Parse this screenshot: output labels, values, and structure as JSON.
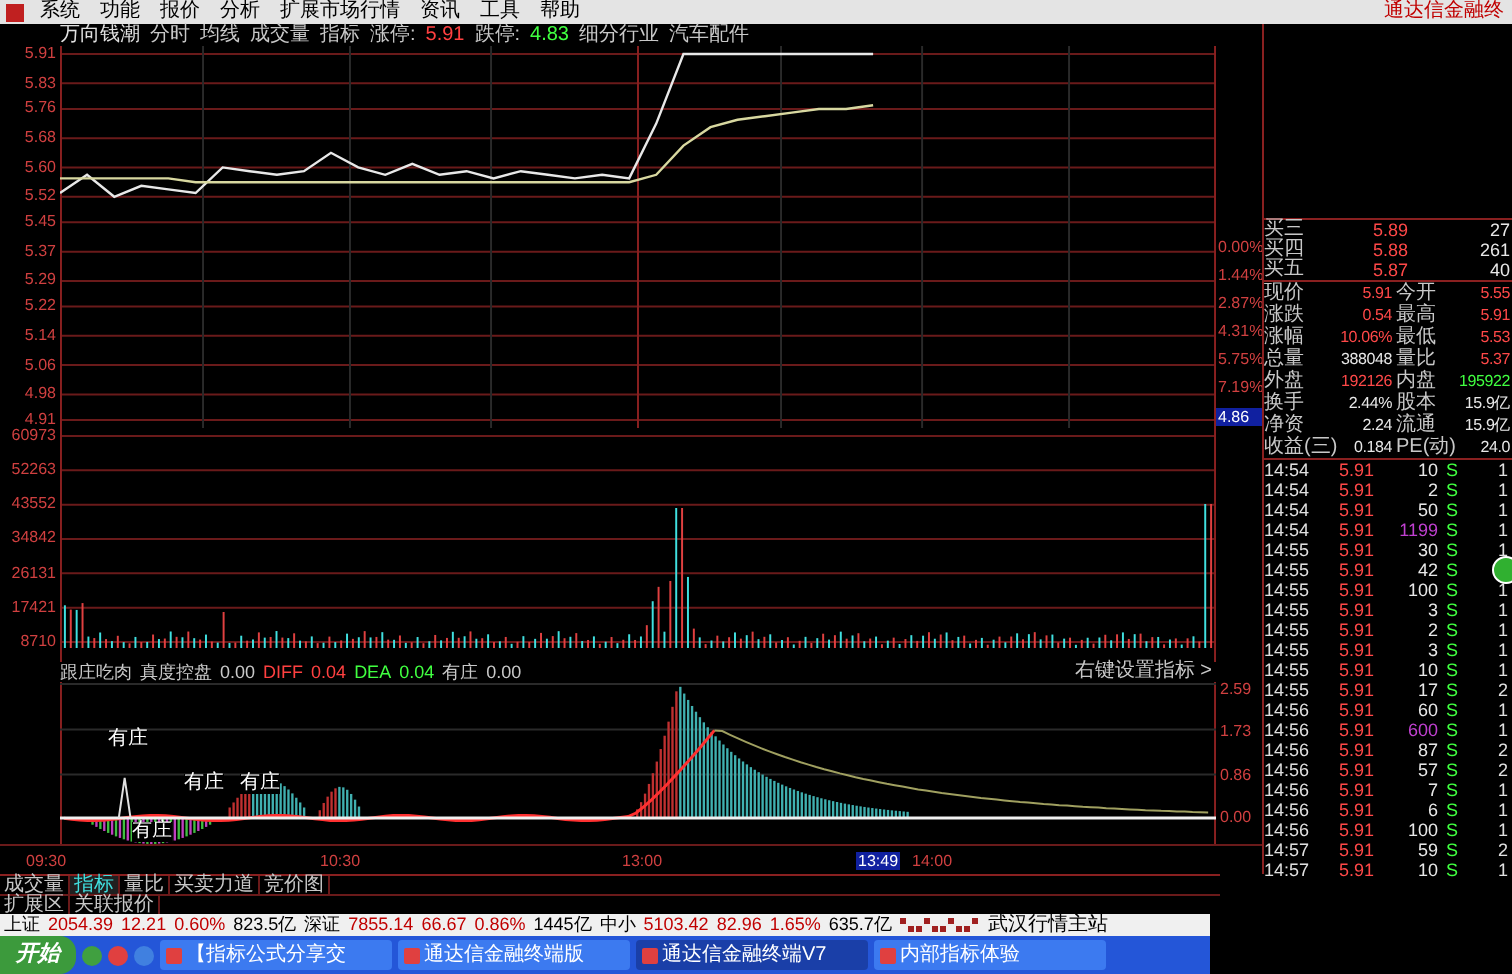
{
  "menu": [
    "系统",
    "功能",
    "报价",
    "分析",
    "扩展市场行情",
    "资讯",
    "工具",
    "帮助"
  ],
  "app_title": "通达信金融终",
  "chart_header": [
    {
      "text": "万向钱潮",
      "kind": "name"
    },
    {
      "text": "分时",
      "kind": "label"
    },
    {
      "text": "均线",
      "kind": "label"
    },
    {
      "text": "成交量",
      "kind": "label"
    },
    {
      "text": "指标",
      "kind": "label"
    },
    {
      "text": "涨停:",
      "kind": "label"
    },
    {
      "text": "5.91",
      "kind": "up"
    },
    {
      "text": "跌停:",
      "kind": "label"
    },
    {
      "text": "4.83",
      "kind": "down"
    },
    {
      "text": "细分行业",
      "kind": "label"
    },
    {
      "text": "汽车配件",
      "kind": "label"
    }
  ],
  "price_chart": {
    "chart_data": {
      "type": "line",
      "categories": [
        null,
        null,
        null,
        null,
        null,
        null,
        null,
        null,
        null,
        null,
        null,
        null,
        null,
        null,
        null,
        null,
        null,
        null,
        null,
        null,
        null,
        null,
        null,
        null,
        null,
        null,
        null,
        null,
        null,
        null,
        null
      ],
      "ylim": [
        4.91,
        5.91
      ],
      "grid": true,
      "yticks": [
        {
          "value": 5.91,
          "label": "5.91"
        },
        {
          "value": 5.83,
          "label": "5.83"
        },
        {
          "value": 5.76,
          "label": "5.76"
        },
        {
          "value": 5.68,
          "label": "5.68"
        },
        {
          "value": 5.6,
          "label": "5.60"
        },
        {
          "value": 5.52,
          "label": "5.52"
        },
        {
          "value": 5.45,
          "label": "5.45"
        },
        {
          "value": 5.37,
          "label": "5.37"
        },
        {
          "value": 5.29,
          "label": "5.29"
        },
        {
          "value": 5.22,
          "label": "5.22"
        },
        {
          "value": 5.14,
          "label": "5.14"
        },
        {
          "value": 5.06,
          "label": "5.06"
        },
        {
          "value": 4.98,
          "label": "4.98"
        },
        {
          "value": 4.91,
          "label": "4.91"
        }
      ],
      "series": [
        {
          "color": "#e8e8e8",
          "values": [
            5.53,
            5.58,
            5.52,
            5.55,
            5.54,
            5.53,
            5.6,
            5.59,
            5.58,
            5.59,
            5.64,
            5.6,
            5.58,
            5.61,
            5.58,
            5.59,
            5.57,
            5.59,
            5.58,
            5.57,
            5.58,
            5.57,
            5.72,
            5.91,
            5.91,
            5.91,
            5.91,
            5.91,
            5.91,
            5.91,
            5.91
          ]
        },
        {
          "color": "#d8d8a0",
          "values": [
            5.57,
            5.57,
            5.57,
            5.57,
            5.57,
            5.56,
            5.56,
            5.56,
            5.56,
            5.56,
            5.56,
            5.56,
            5.56,
            5.56,
            5.56,
            5.56,
            5.56,
            5.56,
            5.56,
            5.56,
            5.56,
            5.56,
            5.58,
            5.66,
            5.71,
            5.73,
            5.74,
            5.75,
            5.76,
            5.76,
            5.77
          ]
        }
      ]
    },
    "percent_axis": [
      "0.00%",
      "1.44%",
      "2.87%",
      "4.31%",
      "5.75%",
      "7.19%"
    ],
    "cursor_price": "4.86"
  },
  "volume_axis": [
    "60973",
    "52263",
    "43552",
    "34842",
    "26131",
    "17421",
    "8710"
  ],
  "time_axis": [
    {
      "text": "09:30",
      "selected": false
    },
    {
      "text": "10:30",
      "selected": false
    },
    {
      "text": "13:00",
      "selected": false
    },
    {
      "text": "13:49",
      "selected": true
    },
    {
      "text": "14:00",
      "selected": false
    }
  ],
  "indicator": {
    "header": [
      {
        "text": "跟庄吃肉",
        "kind": "label"
      },
      {
        "text": "真度控盘",
        "kind": "label"
      },
      {
        "text": "0.00",
        "kind": "label"
      },
      {
        "text": "DIFF",
        "kind": "up"
      },
      {
        "text": "0.04",
        "kind": "up"
      },
      {
        "text": "DEA",
        "kind": "down"
      },
      {
        "text": "0.04",
        "kind": "down"
      },
      {
        "text": "有庄",
        "kind": "label"
      },
      {
        "text": "0.00",
        "kind": "label"
      }
    ],
    "settings_link": "右键设置指标 >",
    "axis": [
      "2.59",
      "1.73",
      "0.86",
      "0.00"
    ],
    "markers": [
      "有庄",
      "有庄",
      "有庄",
      "有庄"
    ]
  },
  "bids": [
    {
      "label": "买三",
      "price": "5.89",
      "volume": "27"
    },
    {
      "label": "买四",
      "price": "5.88",
      "volume": "261"
    },
    {
      "label": "买五",
      "price": "5.87",
      "volume": "40"
    }
  ],
  "stats": [
    {
      "label": "现价",
      "value": "5.91",
      "color": "#ff4848"
    },
    {
      "label": "今开",
      "value": "5.55",
      "color": "#ff4848"
    },
    {
      "label": "涨跌",
      "value": "0.54",
      "color": "#ff4848"
    },
    {
      "label": "最高",
      "value": "5.91",
      "color": "#ff4848"
    },
    {
      "label": "涨幅",
      "value": "10.06%",
      "color": "#ff4848"
    },
    {
      "label": "最低",
      "value": "5.53",
      "color": "#ff4848"
    },
    {
      "label": "总量",
      "value": "388048",
      "color": "#e8e8e8"
    },
    {
      "label": "量比",
      "value": "5.37",
      "color": "#ff4848"
    },
    {
      "label": "外盘",
      "value": "192126",
      "color": "#ff4848"
    },
    {
      "label": "内盘",
      "value": "195922",
      "color": "#40ff40"
    },
    {
      "label": "换手",
      "value": "2.44%",
      "color": "#e8e8e8"
    },
    {
      "label": "股本",
      "value": "15.9亿",
      "color": "#e8e8e8"
    },
    {
      "label": "净资",
      "value": "2.24",
      "color": "#e8e8e8"
    },
    {
      "label": "流通",
      "value": "15.9亿",
      "color": "#e8e8e8"
    },
    {
      "label": "收益(三)",
      "value": "0.184",
      "color": "#e8e8e8"
    },
    {
      "label": "PE(动)",
      "value": "24.0",
      "color": "#e8e8e8"
    }
  ],
  "ticks": [
    {
      "time": "14:54",
      "price": "5.91",
      "volume": "10",
      "side": "S",
      "count": "1",
      "large": false
    },
    {
      "time": "14:54",
      "price": "5.91",
      "volume": "2",
      "side": "S",
      "count": "1",
      "large": false
    },
    {
      "time": "14:54",
      "price": "5.91",
      "volume": "50",
      "side": "S",
      "count": "1",
      "large": false
    },
    {
      "time": "14:54",
      "price": "5.91",
      "volume": "1199",
      "side": "S",
      "count": "1",
      "large": true
    },
    {
      "time": "14:55",
      "price": "5.91",
      "volume": "30",
      "side": "S",
      "count": "1",
      "large": false
    },
    {
      "time": "14:55",
      "price": "5.91",
      "volume": "42",
      "side": "S",
      "large": false
    },
    {
      "time": "14:55",
      "price": "5.91",
      "volume": "100",
      "side": "S",
      "count": "1",
      "large": false
    },
    {
      "time": "14:55",
      "price": "5.91",
      "volume": "3",
      "side": "S",
      "count": "1",
      "large": false
    },
    {
      "time": "14:55",
      "price": "5.91",
      "volume": "2",
      "side": "S",
      "count": "1",
      "large": false
    },
    {
      "time": "14:55",
      "price": "5.91",
      "volume": "3",
      "side": "S",
      "count": "1",
      "large": false
    },
    {
      "time": "14:55",
      "price": "5.91",
      "volume": "10",
      "side": "S",
      "count": "1",
      "large": false
    },
    {
      "time": "14:55",
      "price": "5.91",
      "volume": "17",
      "side": "S",
      "count": "2",
      "large": false
    },
    {
      "time": "14:56",
      "price": "5.91",
      "volume": "60",
      "side": "S",
      "count": "1",
      "large": false
    },
    {
      "time": "14:56",
      "price": "5.91",
      "volume": "600",
      "side": "S",
      "count": "1",
      "large": true
    },
    {
      "time": "14:56",
      "price": "5.91",
      "volume": "87",
      "side": "S",
      "count": "2",
      "large": false
    },
    {
      "time": "14:56",
      "price": "5.91",
      "volume": "57",
      "side": "S",
      "count": "2",
      "large": false
    },
    {
      "time": "14:56",
      "price": "5.91",
      "volume": "7",
      "side": "S",
      "count": "1",
      "large": false
    },
    {
      "time": "14:56",
      "price": "5.91",
      "volume": "6",
      "side": "S",
      "count": "1",
      "large": false
    },
    {
      "time": "14:56",
      "price": "5.91",
      "volume": "100",
      "side": "S",
      "count": "1",
      "large": false
    },
    {
      "time": "14:57",
      "price": "5.91",
      "volume": "59",
      "side": "S",
      "count": "2",
      "large": false
    },
    {
      "time": "14:57",
      "price": "5.91",
      "volume": "10",
      "side": "S",
      "count": "1",
      "large": false
    }
  ],
  "bottom_tabs": [
    {
      "label": "成交量",
      "selected": false
    },
    {
      "label": "指标",
      "selected": true
    },
    {
      "label": "量比",
      "selected": false
    },
    {
      "label": "买卖力道",
      "selected": false
    },
    {
      "label": "竞价图",
      "selected": false
    }
  ],
  "extra_tabs": [
    "扩展区",
    "关联报价"
  ],
  "status_bar": [
    {
      "text": "上证",
      "color": "#000000"
    },
    {
      "text": "2054.39",
      "color": "#c00000"
    },
    {
      "text": "12.21",
      "color": "#c00000"
    },
    {
      "text": "0.60%",
      "color": "#c00000"
    },
    {
      "text": "823.5亿",
      "color": "#000000"
    },
    {
      "text": "深证",
      "color": "#000000"
    },
    {
      "text": "7855.14",
      "color": "#c00000"
    },
    {
      "text": "66.67",
      "color": "#c00000"
    },
    {
      "text": "0.86%",
      "color": "#c00000"
    },
    {
      "text": "1445亿",
      "color": "#000000"
    },
    {
      "text": "中小",
      "color": "#000000"
    },
    {
      "text": "5103.42",
      "color": "#c00000"
    },
    {
      "text": "82.96",
      "color": "#c00000"
    },
    {
      "text": "1.65%",
      "color": "#c00000"
    },
    {
      "text": "635.7亿",
      "color": "#000000"
    }
  ],
  "server": "武汉行情主站",
  "taskbar": {
    "start": "开始",
    "windows": [
      {
        "label": "【指标公式分享交",
        "selected": false
      },
      {
        "label": "通达信金融终端版",
        "selected": false
      },
      {
        "label": "通达信金融终端V7",
        "selected": true
      },
      {
        "label": "内部指标体验",
        "selected": false
      }
    ]
  }
}
